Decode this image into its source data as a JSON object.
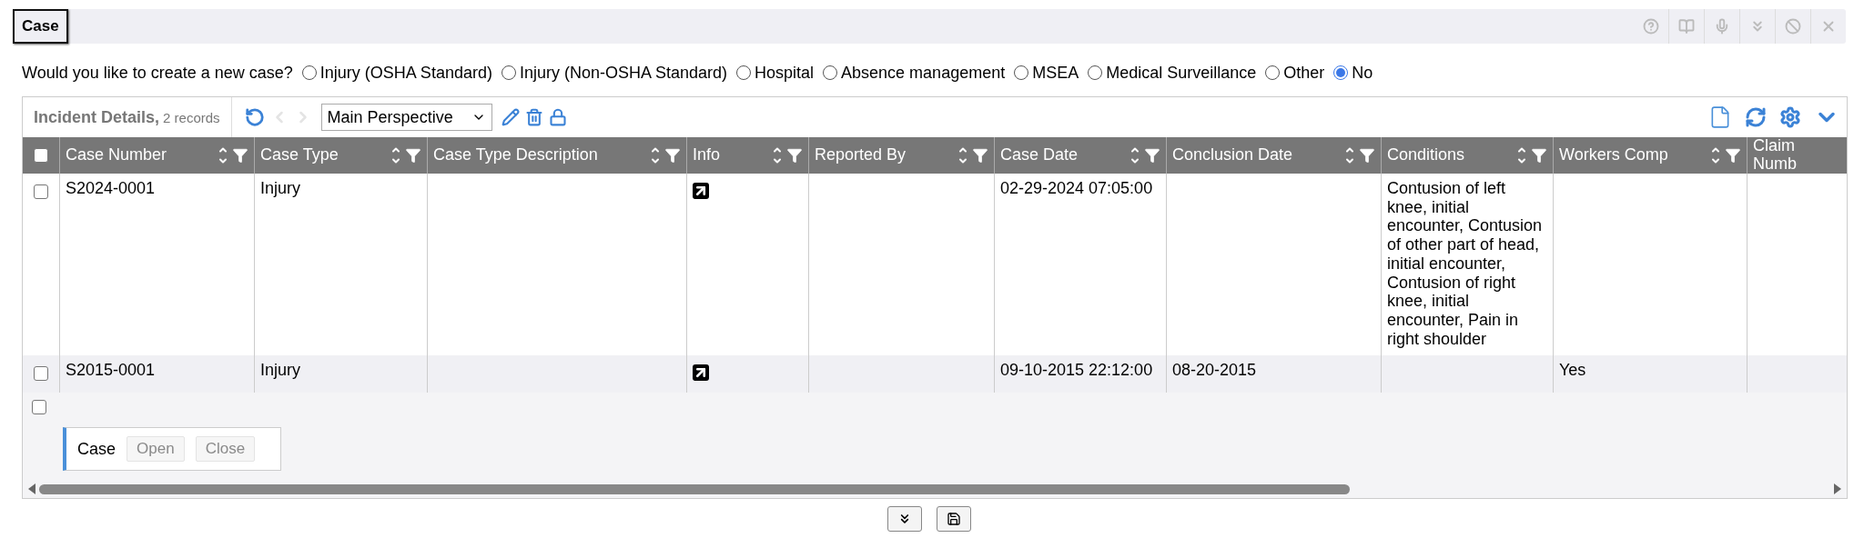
{
  "header": {
    "title": "Case"
  },
  "question": {
    "label": "Would you like to create a new case?",
    "options": [
      {
        "label": "Injury (OSHA Standard)",
        "selected": false
      },
      {
        "label": "Injury (Non-OSHA Standard)",
        "selected": false
      },
      {
        "label": "Hospital",
        "selected": false
      },
      {
        "label": "Absence management",
        "selected": false
      },
      {
        "label": "MSEA",
        "selected": false
      },
      {
        "label": "Medical Surveillance",
        "selected": false
      },
      {
        "label": "Other",
        "selected": false
      },
      {
        "label": "No",
        "selected": true
      }
    ]
  },
  "grid": {
    "select_all": {
      "checked": false
    },
    "title": "Incident Details,",
    "count": "2 records",
    "perspective": "Main Perspective",
    "columns": [
      {
        "label": "Case Number",
        "tools": true
      },
      {
        "label": "Case Type",
        "tools": true
      },
      {
        "label": "Case Type Description",
        "tools": true
      },
      {
        "label": "Info",
        "tools": true
      },
      {
        "label": "Reported By",
        "tools": true
      },
      {
        "label": "Case Date",
        "tools": true
      },
      {
        "label": "Conclusion Date",
        "tools": true
      },
      {
        "label": "Conditions",
        "tools": true
      },
      {
        "label": "Workers Comp",
        "tools": true
      },
      {
        "label": "Claim Numb",
        "tools": false
      }
    ],
    "rows": [
      {
        "checked": false,
        "cells": [
          "S2024-0001",
          "Injury",
          "",
          "",
          "",
          "02-29-2024 07:05:00",
          "",
          "Contusion of left knee, initial encounter, Contusion of other part of head, initial encounter, Contusion of right knee, initial encounter, Pain in right shoulder",
          "",
          ""
        ]
      },
      {
        "checked": false,
        "cells": [
          "S2015-0001",
          "Injury",
          "",
          "",
          "",
          "09-10-2015 22:12:00",
          "08-20-2015",
          "",
          "Yes",
          ""
        ]
      }
    ],
    "new_row": {
      "checked": false
    },
    "actions": {
      "label": "Case",
      "buttons": [
        {
          "label": "Open",
          "disabled": true
        },
        {
          "label": "Close",
          "disabled": true
        }
      ]
    }
  }
}
